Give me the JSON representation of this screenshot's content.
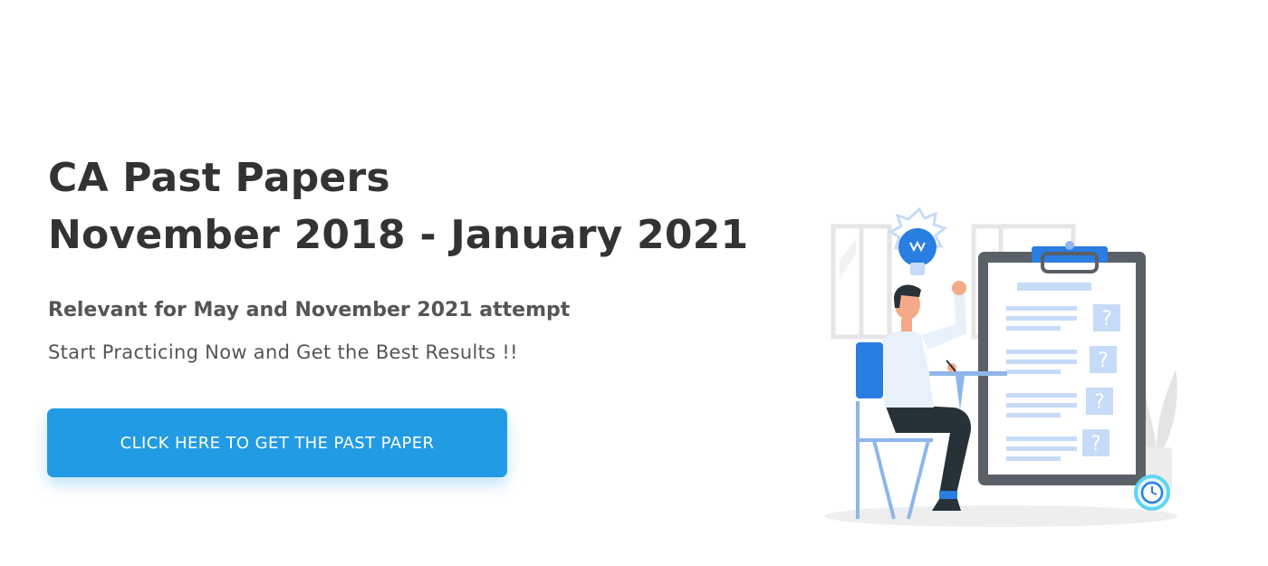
{
  "hero": {
    "title_line1": "CA Past Papers",
    "title_line2": "November 2018 - January 2021",
    "subtitle": "Relevant for May and November 2021 attempt",
    "tagline": "Start Practicing Now and Get the Best Results !!",
    "cta_label": "CLICK HERE TO GET THE PAST PAPER"
  },
  "illustration": {
    "question_mark": "?",
    "icons": [
      "lightbulb-icon",
      "clipboard-icon",
      "clock-icon",
      "chair-icon",
      "plant-icon",
      "window-icon"
    ]
  },
  "colors": {
    "background": "#ffffff",
    "heading": "#333333",
    "body_text": "#555555",
    "button": "#229be5",
    "button_text": "#ffffff",
    "accent_blue": "#2a7de1",
    "light_blue": "#c6dbf7"
  }
}
